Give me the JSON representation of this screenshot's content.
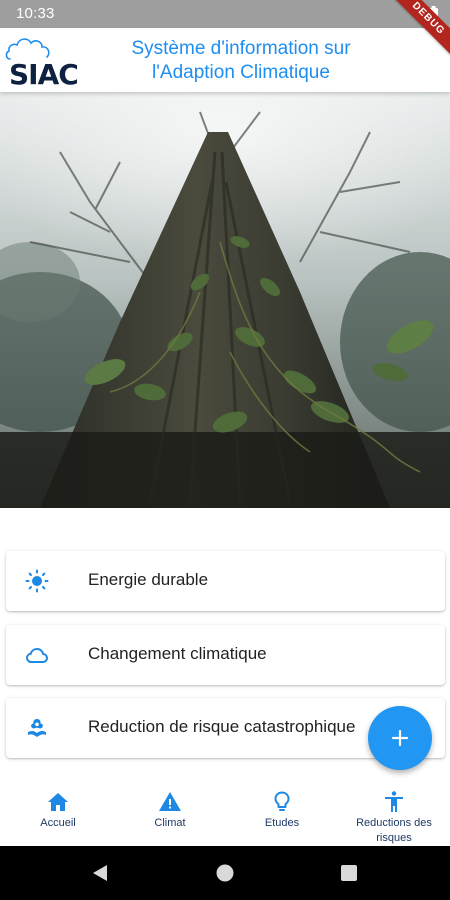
{
  "status_bar": {
    "time": "10:33",
    "debug_label": "DEBUG",
    "battery_icon": "battery-icon"
  },
  "app_bar": {
    "logo_text": "SIAC",
    "logo_icon": "cloud-icon",
    "title_line1": "Système d'information sur",
    "title_line2": "l'Adaption Climatique"
  },
  "colors": {
    "accent": "#1f8ef1",
    "fab": "#2196f3",
    "nav_icon": "#1e88e5",
    "nav_text": "#1e3a66",
    "logo_dark": "#0f2140"
  },
  "menu": {
    "items": [
      {
        "label": "Energie durable",
        "icon": "sun-icon"
      },
      {
        "label": "Changement climatique",
        "icon": "cloud-icon"
      },
      {
        "label": "Reduction de risque catastrophique",
        "icon": "hand-plant-icon"
      }
    ]
  },
  "fab": {
    "icon": "plus-icon"
  },
  "bottom_nav": {
    "items": [
      {
        "label": "Accueil",
        "icon": "home-icon"
      },
      {
        "label": "Climat",
        "icon": "warning-icon"
      },
      {
        "label": "Etudes",
        "icon": "lightbulb-icon"
      },
      {
        "label": "Reductions des risques",
        "icon": "accessibility-icon"
      }
    ]
  },
  "system_nav": {
    "icons": [
      "back-icon",
      "home-circle-icon",
      "recents-icon"
    ]
  }
}
